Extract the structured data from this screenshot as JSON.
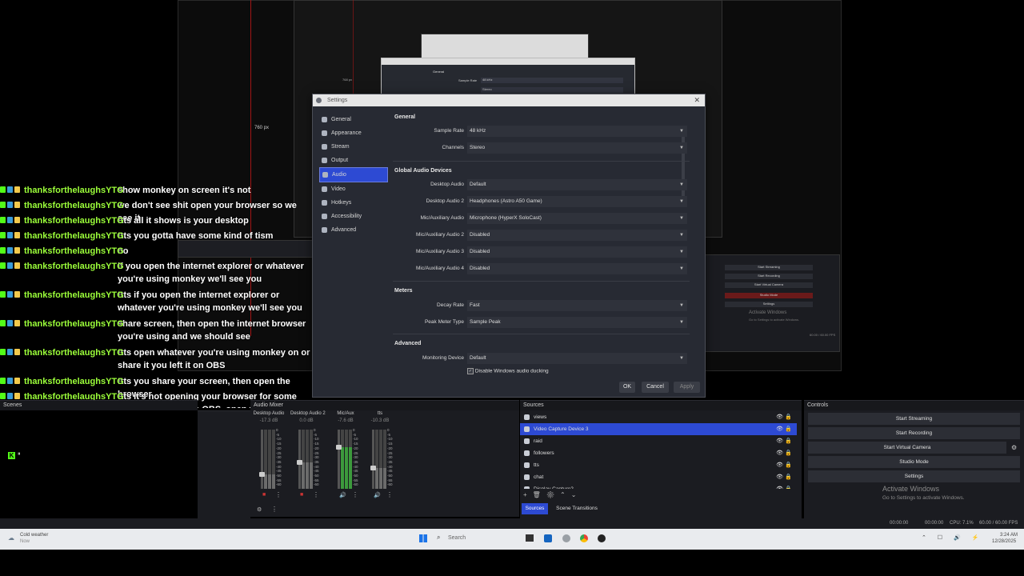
{
  "background": {
    "size_label_760": "760 px",
    "size_label_small": "768 px",
    "ghost_general": "General",
    "ghost_sample_rate": "Sample Rate",
    "ghost_48khz": "48 kHz",
    "ghost_stereo": "Stereo",
    "ghost_start_streaming": "Start Streaming",
    "ghost_start_recording": "Start Recording",
    "ghost_start_virtual": "Start Virtual Camera",
    "ghost_studio": "Studio Mode",
    "ghost_settings": "Settings",
    "ghost_activate": "Activate Windows",
    "ghost_activate_sub": "Go to Settings to activate Windows.",
    "ghost_fps": "60.00 / 60.00 FPS"
  },
  "chat": {
    "messages": [
      {
        "user": "thanksforthelaughsYTG",
        "text": "show monkey on screen it's not"
      },
      {
        "user": "thanksforthelaughsYTG",
        "text": "we don't see shit open your browser so we see it"
      },
      {
        "user": "thanksforthelaughsYTG",
        "text": "!tts all it shows is your desktop"
      },
      {
        "user": "thanksforthelaughsYTG",
        "text": "!tts you gotta have some kind of tism"
      },
      {
        "user": "thanksforthelaughsYTG",
        "text": "no"
      },
      {
        "user": "thanksforthelaughsYTG",
        "text": "if you open the internet explorer or whatever you're using monkey we'll see you"
      },
      {
        "user": "thanksforthelaughsYTG",
        "text": "!tts if you open the internet explorer or whatever you're using monkey we'll see you"
      },
      {
        "user": "thanksforthelaughsYTG",
        "text": "share screen, then open the internet browser you're using and we should see"
      },
      {
        "user": "thanksforthelaughsYTG",
        "text": "!tts open whatever you're using monkey on or share it you left it on OBS"
      },
      {
        "user": "thanksforthelaughsYTG",
        "text": "!tts you share your screen, then open the browser"
      },
      {
        "user": "thanksforthelaughsYTG",
        "text": "!tts it's not opening your browser for some reason it's stayin in OBS, open your browser that monkey is"
      }
    ]
  },
  "settings": {
    "title": "Settings",
    "nav": [
      "General",
      "Appearance",
      "Stream",
      "Output",
      "Audio",
      "Video",
      "Hotkeys",
      "Accessibility",
      "Advanced"
    ],
    "selected_nav_index": 4,
    "sections": {
      "general": "General",
      "global": "Global Audio Devices",
      "meters": "Meters",
      "advanced": "Advanced"
    },
    "fields": {
      "sample_rate": {
        "label": "Sample Rate",
        "value": "48 kHz"
      },
      "channels": {
        "label": "Channels",
        "value": "Stereo"
      },
      "desktop_audio": {
        "label": "Desktop Audio",
        "value": "Default"
      },
      "desktop_audio_2": {
        "label": "Desktop Audio 2",
        "value": "Headphones (Astro A50 Game)"
      },
      "mic_aux": {
        "label": "Mic/Auxiliary Audio",
        "value": "Microphone (HyperX SoloCast)"
      },
      "mic_aux_2": {
        "label": "Mic/Auxiliary Audio 2",
        "value": "Disabled"
      },
      "mic_aux_3": {
        "label": "Mic/Auxiliary Audio 3",
        "value": "Disabled"
      },
      "mic_aux_4": {
        "label": "Mic/Auxiliary Audio 4",
        "value": "Disabled"
      },
      "decay_rate": {
        "label": "Decay Rate",
        "value": "Fast"
      },
      "peak_meter": {
        "label": "Peak Meter Type",
        "value": "Sample Peak"
      },
      "monitoring": {
        "label": "Monitoring Device",
        "value": "Default"
      }
    },
    "ducking_label": "Disable Windows audio ducking",
    "ducking_checked": true,
    "buttons": {
      "ok": "OK",
      "cancel": "Cancel",
      "apply": "Apply"
    }
  },
  "docks": {
    "scenes_title": "Scenes",
    "mixer_title": "Audio Mixer",
    "sources_title": "Sources",
    "controls_title": "Controls",
    "mixer_channels": [
      {
        "name": "Desktop Audio",
        "db": "-17.3 dB"
      },
      {
        "name": "Desktop Audio 2",
        "db": "0.0 dB"
      },
      {
        "name": "Mic/Aux",
        "db": "-7.6 dB"
      },
      {
        "name": "tts",
        "db": "-10.3 dB"
      }
    ],
    "meter_ticks": [
      "0",
      "-5",
      "-10",
      "-15",
      "-20",
      "-25",
      "-30",
      "-35",
      "-40",
      "-45",
      "-50",
      "-55",
      "-60"
    ],
    "sources": [
      "views",
      "Video Capture Device 3",
      "raid",
      "followers",
      "tts",
      "chat",
      "Display Capture2"
    ],
    "selected_source_index": 1,
    "tabs": {
      "sources": "Sources",
      "transitions": "Scene Transitions"
    },
    "controls": [
      "Start Streaming",
      "Start Recording",
      "Start Virtual Camera",
      "Studio Mode",
      "Settings"
    ],
    "activate_title": "Activate Windows",
    "activate_sub": "Go to Settings to activate Windows."
  },
  "statusbar": {
    "time1": "00:00:00",
    "time2": "00:00:00",
    "cpu": "CPU: 7.1%",
    "fps": "60.00 / 60.00 FPS"
  },
  "taskbar": {
    "weather_title": "Cold weather",
    "weather_sub": "Now",
    "search_placeholder": "Search",
    "clock_time": "3:24 AM",
    "clock_date": "12/28/2025"
  },
  "colors": {
    "accent": "#2d4ad3",
    "chat_username": "#9cff3a",
    "dialog_bg": "#272a33",
    "dock_bg": "#1b1c21"
  }
}
